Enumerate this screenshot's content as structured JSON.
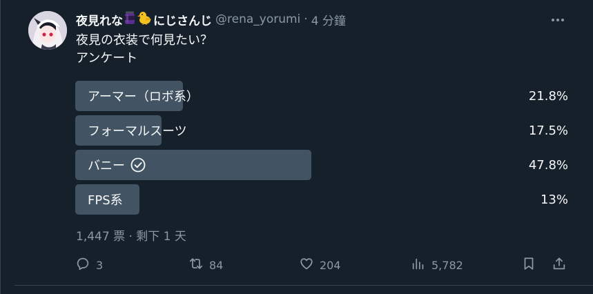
{
  "author": {
    "name_part1": "夜見れな",
    "name_part2": "にじさんじ",
    "handle": "@rena_yorumi",
    "separator": "·",
    "time": "4 分鐘"
  },
  "tweet": {
    "text_line1": "夜見の衣装で何見たい？",
    "text_line2": "アンケート"
  },
  "poll": {
    "options": [
      {
        "label": "アーマー（ロボ系）",
        "percent": "21.8%",
        "fraction": 0.218
      },
      {
        "label": "フォーマルスーツ",
        "percent": "17.5%",
        "fraction": 0.175
      },
      {
        "label": "バニー",
        "percent": "47.8%",
        "fraction": 0.478,
        "selected": true
      },
      {
        "label": "FPS系",
        "percent": "13%",
        "fraction": 0.13
      }
    ],
    "meta": "1,447 票 · 剩下 1 天"
  },
  "actions": {
    "replies": "3",
    "retweets": "84",
    "likes": "204",
    "views": "5,782"
  },
  "colors": {
    "background": "#15202b",
    "poll_bar": "#425364",
    "muted_text": "#8b98a5",
    "primary_text": "#f7f9f9"
  },
  "icons": [
    "more-icon",
    "reply-icon",
    "retweet-icon",
    "like-icon",
    "views-icon",
    "bookmark-icon",
    "share-icon",
    "check-circle-icon",
    "jar-emoji-icon",
    "chick-emoji-icon"
  ]
}
